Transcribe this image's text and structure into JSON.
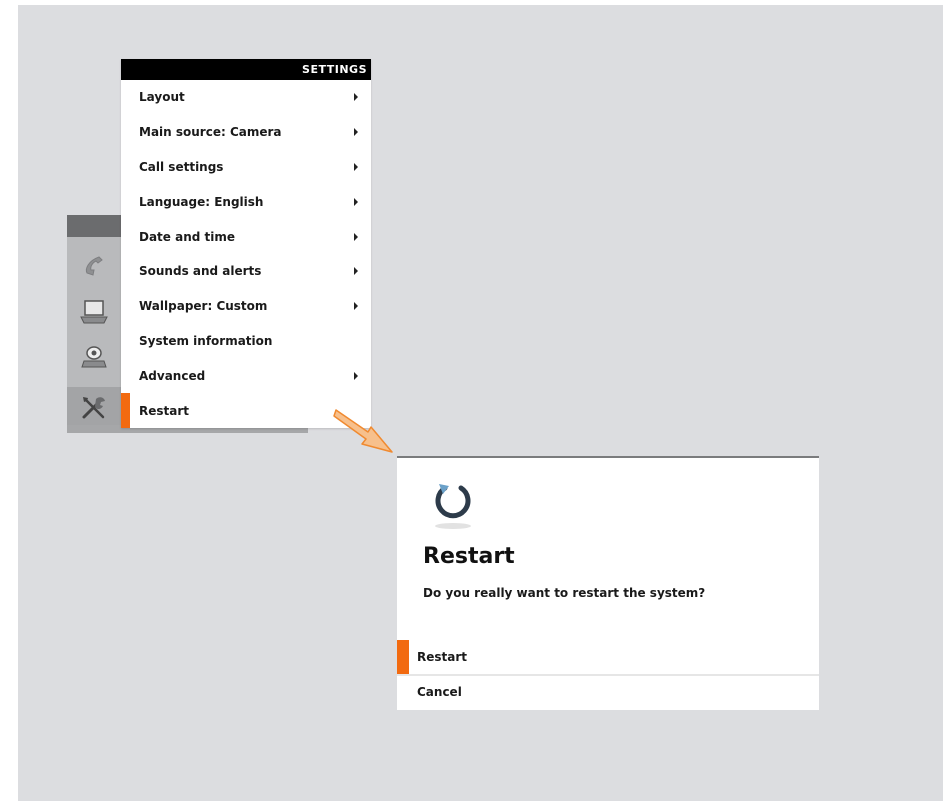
{
  "menu": {
    "title": "SETTINGS",
    "items": [
      {
        "label": "Layout",
        "submenu": true
      },
      {
        "label": "Main source: Camera",
        "submenu": true
      },
      {
        "label": "Call settings",
        "submenu": true
      },
      {
        "label": "Language: English",
        "submenu": true
      },
      {
        "label": "Date and time",
        "submenu": true
      },
      {
        "label": "Sounds and alerts",
        "submenu": true
      },
      {
        "label": "Wallpaper: Custom",
        "submenu": true
      },
      {
        "label": "System information",
        "submenu": false
      },
      {
        "label": "Advanced",
        "submenu": true
      },
      {
        "label": "Restart",
        "submenu": false,
        "selected": true
      }
    ]
  },
  "launcher": {
    "icons": [
      "phone-icon",
      "laptop-icon",
      "camera-icon",
      "settings-tools-icon"
    ]
  },
  "dialog": {
    "icon": "restart-icon",
    "title": "Restart",
    "message": "Do you really want to restart the system?",
    "confirm_label": "Restart",
    "cancel_label": "Cancel"
  },
  "colors": {
    "accent": "#f26a10",
    "background": "#dcdde0",
    "header": "#000000"
  }
}
